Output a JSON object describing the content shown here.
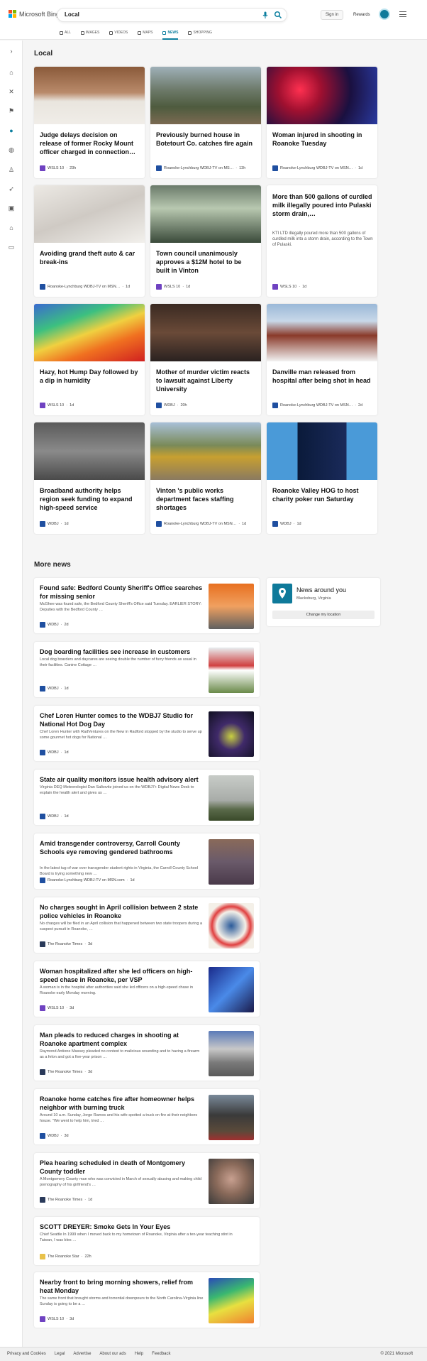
{
  "brand": {
    "name": "Microsoft Bing"
  },
  "search": {
    "query": "Local"
  },
  "header": {
    "signin": "Sign in",
    "rewards": "Rewards"
  },
  "scopes": [
    "ALL",
    "IMAGES",
    "VIDEOS",
    "MAPS",
    "NEWS",
    "SHOPPING"
  ],
  "colors": {
    "accent": "#0c7f9f",
    "brand_blue": "#0f7a9a"
  },
  "local": {
    "heading": "Local",
    "cards": [
      {
        "title": "Judge delays decision on release of former Rocky Mount officer charged in connection…",
        "source": "WSLS 10",
        "time": "23h",
        "logo": "#6f42c1"
      },
      {
        "title": "Previously burned house in Botetourt Co. catches fire again",
        "source": "Roanoke-Lynchburg WDBJ-TV on MS…",
        "time": "13h",
        "logo": "#1f4fa0"
      },
      {
        "title": "Woman injured in shooting in Roanoke Tuesday",
        "source": "Roanoke-Lynchburg WDBJ-TV on MSN…",
        "time": "1d",
        "logo": "#1f4fa0"
      },
      {
        "title": "Avoiding grand theft auto & car break-ins",
        "source": "Roanoke-Lynchburg WDBJ-TV on MSN…",
        "time": "1d",
        "logo": "#1f4fa0"
      },
      {
        "title": "Town council unanimously approves a $12M hotel to be built in Vinton",
        "source": "WSLS 10",
        "time": "1d",
        "logo": "#6f42c1"
      },
      {
        "title": "More than 500 gallons of curdled milk illegally poured into Pulaski storm drain,…",
        "desc": "KTI LTD illegally poured more than 500 gallons of curdled milk into a storm drain, according to the Town of Pulaski.",
        "source": "WSLS 10",
        "time": "1d",
        "logo": "#6f42c1"
      },
      {
        "title": "Hazy, hot Hump Day followed by a dip in humidity",
        "source": "WSLS 10",
        "time": "1d",
        "logo": "#6f42c1"
      },
      {
        "title": "Mother of murder victim reacts to lawsuit against Liberty University",
        "source": "WDBJ",
        "time": "20h",
        "logo": "#1f4fa0"
      },
      {
        "title": "Danville man released from hospital after being shot in head",
        "source": "Roanoke-Lynchburg WDBJ-TV on MSN…",
        "time": "2d",
        "logo": "#1f4fa0"
      },
      {
        "title": "Broadband authority helps region seek funding to expand high-speed service",
        "source": "WDBJ",
        "time": "1d",
        "logo": "#1f4fa0"
      },
      {
        "title": "Vinton 's public works department faces staffing shortages",
        "source": "Roanoke-Lynchburg WDBJ-TV on MSN…",
        "time": "1d",
        "logo": "#1f4fa0"
      },
      {
        "title": "Roanoke Valley HOG to host charity poker run Saturday",
        "source": "WDBJ",
        "time": "1d",
        "logo": "#1f4fa0"
      }
    ]
  },
  "more": {
    "heading": "More news",
    "items": [
      {
        "title": "Found safe: Bedford County Sheriff's Office searches for missing senior",
        "desc": "McGhee was found safe, the Bedford County Sheriff's Office said Tuesday. EARLIER STORY: Deputies with the Bedford County …",
        "source": "WDBJ",
        "time": "2d",
        "logo": "#1f4fa0"
      },
      {
        "title": "Dog boarding facilities see increase in customers",
        "desc": "Local dog boarders and daycares are seeing double the number of furry friends as usual in their facilities. Canine Cottage …",
        "source": "WDBJ",
        "time": "1d",
        "logo": "#1f4fa0"
      },
      {
        "title": "Chef Loren Hunter comes to the WDBJ7 Studio for National Hot Dog Day",
        "desc": "Chef Loren Hunter with RadVentures on the New in Radford stopped by the studio to serve up some gourmet hot dogs for National …",
        "source": "WDBJ",
        "time": "1d",
        "logo": "#1f4fa0"
      },
      {
        "title": "State air quality monitors issue health advisory alert",
        "desc": "Virginia DEQ Meteorologist Dan Salkovitz joined us on the WDBJ7+ Digital News Desk to explain the health alert and gives us …",
        "source": "WDBJ",
        "time": "1d",
        "logo": "#1f4fa0"
      },
      {
        "title": "Amid transgender controversy, Carroll County Schools eye removing gendered bathrooms",
        "desc": "In the latest tug of war over transgender student rights in Virginia, the Carroll County School Board is trying something new …",
        "source": "Roanoke-Lynchburg WDBJ-TV on MSN.com",
        "time": "1d",
        "logo": "#1f4fa0"
      },
      {
        "title": "No charges sought in April collision between 2 state police vehicles in Roanoke",
        "desc": "No charges will be filed in an April collision that happened between two state troopers during a suspect pursuit in Roanoke, …",
        "source": "The Roanoke Times",
        "time": "3d",
        "logo": "#2a3a5a"
      },
      {
        "title": "Woman hospitalized after she led officers on high-speed chase in Roanoke, per VSP",
        "desc": "A woman is in the hospital after authorities said she led officers on a high-speed chase in Roanoke early Monday morning.",
        "source": "WSLS 10",
        "time": "3d",
        "logo": "#6f42c1"
      },
      {
        "title": "Man pleads to reduced charges in shooting at Roanoke apartment complex",
        "desc": "Raymond Antione Massey pleaded no contest to malicious wounding and to having a firearm as a felon and got a five-year prison …",
        "source": "The Roanoke Times",
        "time": "3d",
        "logo": "#2a3a5a"
      },
      {
        "title": "Roanoke home catches fire after homeowner helps neighbor with burning truck",
        "desc": "Around 10 a.m. Sunday, Jorge Ramos and his wife spotted a truck on fire at their neighbors house. \"We went to help him, tried …",
        "source": "WDBJ",
        "time": "3d",
        "logo": "#1f4fa0"
      },
      {
        "title": "Plea hearing scheduled in death of Montgomery County toddler",
        "desc": "A Montgomery County man who was convicted in March of sexually abusing and making child pornography of his girlfriend's …",
        "source": "The Roanoke Times",
        "time": "1d",
        "logo": "#2a3a5a"
      },
      {
        "title": "SCOTT DREYER: Smoke Gets In Your Eyes",
        "desc": "Chief Seattle In 1999 when I moved back to my hometown of Roanoke, Virginia after a ten-year teaching stint in Taiwan, I was bles …",
        "source": "The Roanoke Star",
        "time": "22h",
        "logo": "#e8c14a"
      },
      {
        "title": "Nearby front to bring morning showers, relief from heat Monday",
        "desc": "The same front that brought storms and torrential downpours to the North Carolina-Virginia line Sunday is going to be a …",
        "source": "WSLS 10",
        "time": "3d",
        "logo": "#6f42c1"
      }
    ]
  },
  "news_around": {
    "title": "News around you",
    "location": "Blacksburg, Virginia",
    "button": "Change my location"
  },
  "footer": {
    "links": [
      "Privacy and Cookies",
      "Legal",
      "Advertise",
      "About our ads",
      "Help",
      "Feedback"
    ],
    "copyright": "© 2021 Microsoft"
  }
}
